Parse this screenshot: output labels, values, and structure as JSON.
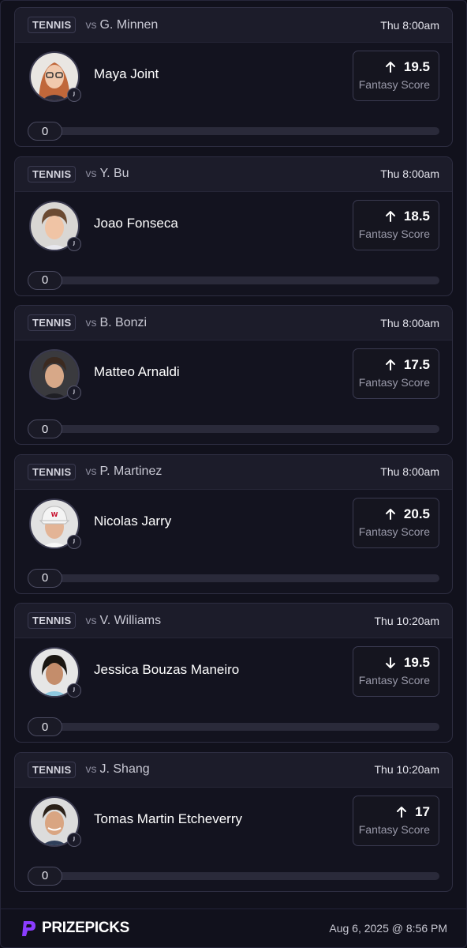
{
  "cards": [
    {
      "sport": "TENNIS",
      "vs_prefix": "vs",
      "opponent": "G. Minnen",
      "time": "Thu 8:00am",
      "player": "Maya Joint",
      "direction": "up",
      "score": "19.5",
      "score_label": "Fantasy Score",
      "progress": "0"
    },
    {
      "sport": "TENNIS",
      "vs_prefix": "vs",
      "opponent": "Y. Bu",
      "time": "Thu 8:00am",
      "player": "Joao Fonseca",
      "direction": "up",
      "score": "18.5",
      "score_label": "Fantasy Score",
      "progress": "0"
    },
    {
      "sport": "TENNIS",
      "vs_prefix": "vs",
      "opponent": "B. Bonzi",
      "time": "Thu 8:00am",
      "player": "Matteo Arnaldi",
      "direction": "up",
      "score": "17.5",
      "score_label": "Fantasy Score",
      "progress": "0"
    },
    {
      "sport": "TENNIS",
      "vs_prefix": "vs",
      "opponent": "P. Martinez",
      "time": "Thu 8:00am",
      "player": "Nicolas Jarry",
      "direction": "up",
      "score": "20.5",
      "score_label": "Fantasy Score",
      "progress": "0"
    },
    {
      "sport": "TENNIS",
      "vs_prefix": "vs",
      "opponent": "V. Williams",
      "time": "Thu 10:20am",
      "player": "Jessica Bouzas Maneiro",
      "direction": "down",
      "score": "19.5",
      "score_label": "Fantasy Score",
      "progress": "0"
    },
    {
      "sport": "TENNIS",
      "vs_prefix": "vs",
      "opponent": "J. Shang",
      "time": "Thu 10:20am",
      "player": "Tomas Martin Etcheverry",
      "direction": "up",
      "score": "17",
      "score_label": "Fantasy Score",
      "progress": "0"
    }
  ],
  "footer": {
    "brand": "PRIZEPICKS",
    "date": "Aug 6, 2025 @ 8:56 PM"
  },
  "colors": {
    "background": "#0d0d17",
    "card": "#13131f",
    "card_header": "#1c1c2a",
    "brand_purple": "#8b3dff"
  }
}
